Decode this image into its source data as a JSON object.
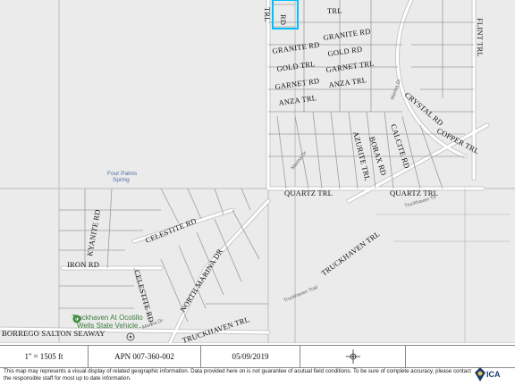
{
  "map": {
    "street_labels": [
      {
        "id": "granite-rd-1",
        "text": "GRANITE RD"
      },
      {
        "id": "granite-rd-2",
        "text": "GRANITE RD"
      },
      {
        "id": "gold-trl",
        "text": "GOLD TRL"
      },
      {
        "id": "gold-rd",
        "text": "GOLD RD"
      },
      {
        "id": "garnet-rd",
        "text": "GARNET RD"
      },
      {
        "id": "garnet-trl",
        "text": "GARNET TRL"
      },
      {
        "id": "anza-trl-1",
        "text": "ANZA TRL"
      },
      {
        "id": "anza-trl-2",
        "text": "ANZA TRL"
      },
      {
        "id": "crystal-rd",
        "text": "CRYSTAL RD"
      },
      {
        "id": "copper-trl",
        "text": "COPPER TRL"
      },
      {
        "id": "calcite-rd",
        "text": "CALCITE RD"
      },
      {
        "id": "borax-rd",
        "text": "BORAX RD"
      },
      {
        "id": "azurite-trl",
        "text": "AZURITE TRL"
      },
      {
        "id": "flint-trl",
        "text": "FLINT TRL"
      },
      {
        "id": "jade-trl",
        "text": "TRL"
      },
      {
        "id": "quartz-trl-1",
        "text": "QUARTZ TRL"
      },
      {
        "id": "quartz-trl-2",
        "text": "QUARTZ TRL"
      },
      {
        "id": "kyanite-rd",
        "text": "KYANITE RD"
      },
      {
        "id": "celestite-rd-1",
        "text": "CELESTITE RD"
      },
      {
        "id": "celestite-rd-2",
        "text": "CELESTITE RD"
      },
      {
        "id": "iron-rd",
        "text": "IRON RD"
      },
      {
        "id": "north-marina-dr",
        "text": "NORTH MARINA DR"
      },
      {
        "id": "truckhaven-trl",
        "text": "TRUCKHAVEN TRL"
      },
      {
        "id": "truckhaven-trl-2",
        "text": "TRUCKHAVEN TRL"
      },
      {
        "id": "borrego-salton",
        "text": "BORREGO SALTON SEAWAY"
      },
      {
        "id": "trl-top",
        "text": "TRL"
      },
      {
        "id": "rd-top",
        "text": "RD"
      }
    ],
    "small_labels": {
      "marina_dr_1": "Marina Dr",
      "marina_dr_2": "Marina Dr",
      "truckhaven_trail": "Truckhaven Trail",
      "truckhaven_trl_small": "Truckhaven Trl",
      "marina_dr_3": "Marina Dr"
    },
    "poi": {
      "spring_line1": "Four Palms",
      "spring_line2": "Spring",
      "park_line1": "Truckhaven At Ocotillo",
      "park_line2": "Wells State Vehicle..."
    }
  },
  "info_bar": {
    "scale": "1'' = 1505 ft",
    "apn": "APN 007-360-002",
    "date": "05/09/2019",
    "compass_icon": "compass-icon"
  },
  "disclaimer": "This map may represents a visual display of related geographic information. Data provided here on is not guarantee of acutual field conditions. To be sure of complete accuracy, please contact the responsible staff for most up to date information.",
  "logo_text": "ICA"
}
